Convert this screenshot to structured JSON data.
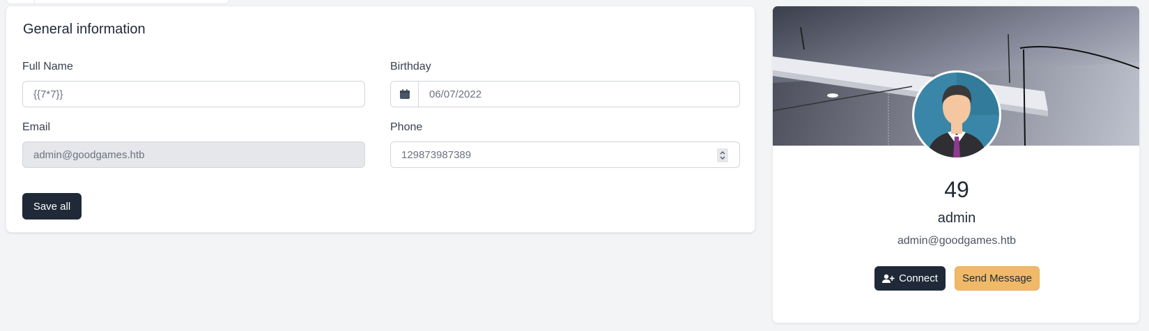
{
  "general": {
    "title": "General information",
    "full_name": {
      "label": "Full Name",
      "value": "{{7*7}}"
    },
    "birthday": {
      "label": "Birthday",
      "value": "06/07/2022"
    },
    "email": {
      "label": "Email",
      "value": "admin@goodgames.htb"
    },
    "phone": {
      "label": "Phone",
      "value": "129873987389"
    },
    "save_label": "Save all"
  },
  "profile": {
    "number": "49",
    "username": "admin",
    "email": "admin@goodgames.htb",
    "connect_label": "Connect",
    "message_label": "Send Message"
  },
  "colors": {
    "primary": "#1f2937",
    "accent": "#f0b968",
    "background": "#f3f4f6"
  }
}
